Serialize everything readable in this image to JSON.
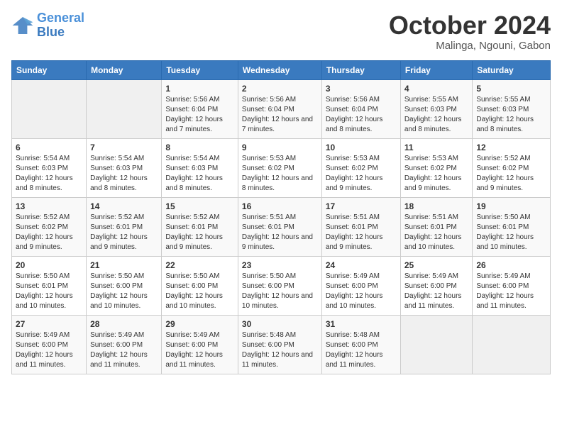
{
  "header": {
    "logo_line1": "General",
    "logo_line2": "Blue",
    "title": "October 2024",
    "location": "Malinga, Ngouni, Gabon"
  },
  "weekdays": [
    "Sunday",
    "Monday",
    "Tuesday",
    "Wednesday",
    "Thursday",
    "Friday",
    "Saturday"
  ],
  "weeks": [
    [
      {
        "day": "",
        "empty": true
      },
      {
        "day": "",
        "empty": true
      },
      {
        "day": "1",
        "sunrise": "Sunrise: 5:56 AM",
        "sunset": "Sunset: 6:04 PM",
        "daylight": "Daylight: 12 hours and 7 minutes."
      },
      {
        "day": "2",
        "sunrise": "Sunrise: 5:56 AM",
        "sunset": "Sunset: 6:04 PM",
        "daylight": "Daylight: 12 hours and 7 minutes."
      },
      {
        "day": "3",
        "sunrise": "Sunrise: 5:56 AM",
        "sunset": "Sunset: 6:04 PM",
        "daylight": "Daylight: 12 hours and 8 minutes."
      },
      {
        "day": "4",
        "sunrise": "Sunrise: 5:55 AM",
        "sunset": "Sunset: 6:03 PM",
        "daylight": "Daylight: 12 hours and 8 minutes."
      },
      {
        "day": "5",
        "sunrise": "Sunrise: 5:55 AM",
        "sunset": "Sunset: 6:03 PM",
        "daylight": "Daylight: 12 hours and 8 minutes."
      }
    ],
    [
      {
        "day": "6",
        "sunrise": "Sunrise: 5:54 AM",
        "sunset": "Sunset: 6:03 PM",
        "daylight": "Daylight: 12 hours and 8 minutes."
      },
      {
        "day": "7",
        "sunrise": "Sunrise: 5:54 AM",
        "sunset": "Sunset: 6:03 PM",
        "daylight": "Daylight: 12 hours and 8 minutes."
      },
      {
        "day": "8",
        "sunrise": "Sunrise: 5:54 AM",
        "sunset": "Sunset: 6:03 PM",
        "daylight": "Daylight: 12 hours and 8 minutes."
      },
      {
        "day": "9",
        "sunrise": "Sunrise: 5:53 AM",
        "sunset": "Sunset: 6:02 PM",
        "daylight": "Daylight: 12 hours and 8 minutes."
      },
      {
        "day": "10",
        "sunrise": "Sunrise: 5:53 AM",
        "sunset": "Sunset: 6:02 PM",
        "daylight": "Daylight: 12 hours and 9 minutes."
      },
      {
        "day": "11",
        "sunrise": "Sunrise: 5:53 AM",
        "sunset": "Sunset: 6:02 PM",
        "daylight": "Daylight: 12 hours and 9 minutes."
      },
      {
        "day": "12",
        "sunrise": "Sunrise: 5:52 AM",
        "sunset": "Sunset: 6:02 PM",
        "daylight": "Daylight: 12 hours and 9 minutes."
      }
    ],
    [
      {
        "day": "13",
        "sunrise": "Sunrise: 5:52 AM",
        "sunset": "Sunset: 6:02 PM",
        "daylight": "Daylight: 12 hours and 9 minutes."
      },
      {
        "day": "14",
        "sunrise": "Sunrise: 5:52 AM",
        "sunset": "Sunset: 6:01 PM",
        "daylight": "Daylight: 12 hours and 9 minutes."
      },
      {
        "day": "15",
        "sunrise": "Sunrise: 5:52 AM",
        "sunset": "Sunset: 6:01 PM",
        "daylight": "Daylight: 12 hours and 9 minutes."
      },
      {
        "day": "16",
        "sunrise": "Sunrise: 5:51 AM",
        "sunset": "Sunset: 6:01 PM",
        "daylight": "Daylight: 12 hours and 9 minutes."
      },
      {
        "day": "17",
        "sunrise": "Sunrise: 5:51 AM",
        "sunset": "Sunset: 6:01 PM",
        "daylight": "Daylight: 12 hours and 9 minutes."
      },
      {
        "day": "18",
        "sunrise": "Sunrise: 5:51 AM",
        "sunset": "Sunset: 6:01 PM",
        "daylight": "Daylight: 12 hours and 10 minutes."
      },
      {
        "day": "19",
        "sunrise": "Sunrise: 5:50 AM",
        "sunset": "Sunset: 6:01 PM",
        "daylight": "Daylight: 12 hours and 10 minutes."
      }
    ],
    [
      {
        "day": "20",
        "sunrise": "Sunrise: 5:50 AM",
        "sunset": "Sunset: 6:01 PM",
        "daylight": "Daylight: 12 hours and 10 minutes."
      },
      {
        "day": "21",
        "sunrise": "Sunrise: 5:50 AM",
        "sunset": "Sunset: 6:00 PM",
        "daylight": "Daylight: 12 hours and 10 minutes."
      },
      {
        "day": "22",
        "sunrise": "Sunrise: 5:50 AM",
        "sunset": "Sunset: 6:00 PM",
        "daylight": "Daylight: 12 hours and 10 minutes."
      },
      {
        "day": "23",
        "sunrise": "Sunrise: 5:50 AM",
        "sunset": "Sunset: 6:00 PM",
        "daylight": "Daylight: 12 hours and 10 minutes."
      },
      {
        "day": "24",
        "sunrise": "Sunrise: 5:49 AM",
        "sunset": "Sunset: 6:00 PM",
        "daylight": "Daylight: 12 hours and 10 minutes."
      },
      {
        "day": "25",
        "sunrise": "Sunrise: 5:49 AM",
        "sunset": "Sunset: 6:00 PM",
        "daylight": "Daylight: 12 hours and 11 minutes."
      },
      {
        "day": "26",
        "sunrise": "Sunrise: 5:49 AM",
        "sunset": "Sunset: 6:00 PM",
        "daylight": "Daylight: 12 hours and 11 minutes."
      }
    ],
    [
      {
        "day": "27",
        "sunrise": "Sunrise: 5:49 AM",
        "sunset": "Sunset: 6:00 PM",
        "daylight": "Daylight: 12 hours and 11 minutes."
      },
      {
        "day": "28",
        "sunrise": "Sunrise: 5:49 AM",
        "sunset": "Sunset: 6:00 PM",
        "daylight": "Daylight: 12 hours and 11 minutes."
      },
      {
        "day": "29",
        "sunrise": "Sunrise: 5:49 AM",
        "sunset": "Sunset: 6:00 PM",
        "daylight": "Daylight: 12 hours and 11 minutes."
      },
      {
        "day": "30",
        "sunrise": "Sunrise: 5:48 AM",
        "sunset": "Sunset: 6:00 PM",
        "daylight": "Daylight: 12 hours and 11 minutes."
      },
      {
        "day": "31",
        "sunrise": "Sunrise: 5:48 AM",
        "sunset": "Sunset: 6:00 PM",
        "daylight": "Daylight: 12 hours and 11 minutes."
      },
      {
        "day": "",
        "empty": true
      },
      {
        "day": "",
        "empty": true
      }
    ]
  ]
}
